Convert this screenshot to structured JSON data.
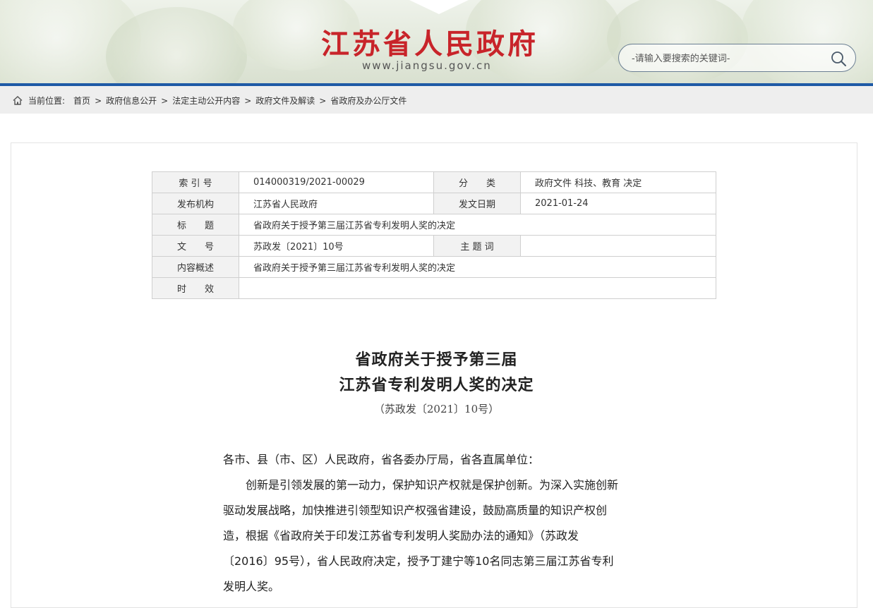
{
  "header": {
    "site_title": "江苏省人民政府",
    "site_url": "www.jiangsu.gov.cn",
    "search_placeholder": "-请输入要搜索的关键词-",
    "accent_color": "#c8242a",
    "rule_color": "#1e5aa6"
  },
  "breadcrumb": {
    "label": "当前位置:",
    "items": [
      "首页",
      "政府信息公开",
      "法定主动公开内容",
      "政府文件及解读",
      "省政府及办公厅文件"
    ],
    "separator": ">"
  },
  "meta": {
    "index_label": "索 引 号",
    "index_value": "014000319/2021-00029",
    "category_label": "分　　类",
    "category_value": "政府文件 科技、教育 决定",
    "issuer_label": "发布机构",
    "issuer_value": "江苏省人民政府",
    "date_label": "发文日期",
    "date_value": "2021-01-24",
    "title_label": "标　　题",
    "title_value": "省政府关于授予第三届江苏省专利发明人奖的决定",
    "docno_label": "文　　号",
    "docno_value": "苏政发〔2021〕10号",
    "keywords_label": "主 题 词",
    "keywords_value": "",
    "summary_label": "内容概述",
    "summary_value": "省政府关于授予第三届江苏省专利发明人奖的决定",
    "validity_label": "时　　效",
    "validity_value": ""
  },
  "document": {
    "title_line1": "省政府关于授予第三届",
    "title_line2": "江苏省专利发明人奖的决定",
    "number": "（苏政发〔2021〕10号）",
    "salutation": "各市、县（市、区）人民政府，省各委办厅局，省各直属单位：",
    "para1_lines": [
      "创新是引领发展的第一动力，保护知识产权就是保护创新。为深入实施创新",
      "驱动发展战略，加快推进引领型知识产权强省建设，鼓励高质量的知识产权创",
      "造，根据《省政府关于印发江苏省专利发明人奖励办法的通知》（苏政发",
      "〔2016〕95号），省人民政府决定，授予丁建宁等10名同志第三届江苏省专利",
      "发明人奖。"
    ]
  }
}
